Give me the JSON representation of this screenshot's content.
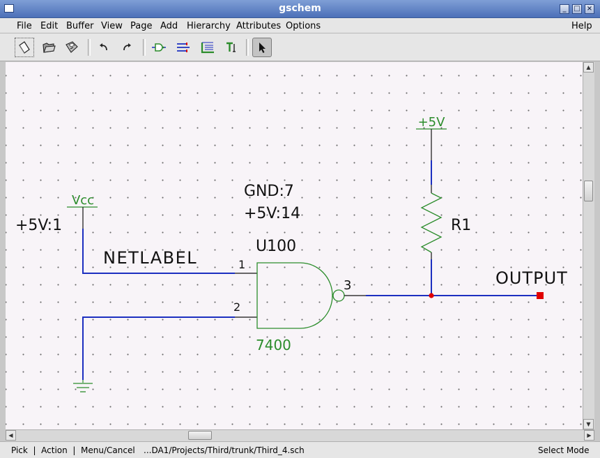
{
  "window": {
    "title": "gschem"
  },
  "menu": [
    "File",
    "Edit",
    "Buffer",
    "View",
    "Page",
    "Add",
    "Hierarchy",
    "Attributes",
    "Options"
  ],
  "help_menu": "Help",
  "toolbar": {
    "buttons": [
      {
        "name": "new-page-icon",
        "tooltip": "New"
      },
      {
        "name": "open-folder-icon",
        "tooltip": "Open"
      },
      {
        "name": "save-disk-icon",
        "tooltip": "Save"
      },
      {
        "name": "undo-icon",
        "tooltip": "Undo"
      },
      {
        "name": "redo-icon",
        "tooltip": "Redo"
      },
      {
        "name": "add-component-icon",
        "tooltip": "Component"
      },
      {
        "name": "add-net-icon",
        "tooltip": "Net"
      },
      {
        "name": "add-bus-icon",
        "tooltip": "Bus"
      },
      {
        "name": "add-text-icon",
        "tooltip": "Text"
      },
      {
        "name": "select-arrow-icon",
        "tooltip": "Select"
      }
    ]
  },
  "schematic": {
    "vcc_label": "Vcc",
    "vcc_attr": "+5V:1",
    "netlabel": "NETLABEL",
    "gate_attr_gnd": "GND:7",
    "gate_attr_vcc": "+5V:14",
    "refdes": "U100",
    "device": "7400",
    "pin1": "1",
    "pin2": "2",
    "pin3": "3",
    "pwr_label": "+5V",
    "resistor": "R1",
    "output_label": "OUTPUT",
    "colors": {
      "net": "#1c2fc0",
      "component": "#2b8c2b",
      "text": "#111111",
      "pin": "#111111",
      "junction": "#e00000"
    }
  },
  "status": {
    "mouse_hints": "Pick  |  Action  |  Menu/Cancel",
    "file": "...DA1/Projects/Third/trunk/Third_4.sch",
    "mode": "Select Mode"
  }
}
